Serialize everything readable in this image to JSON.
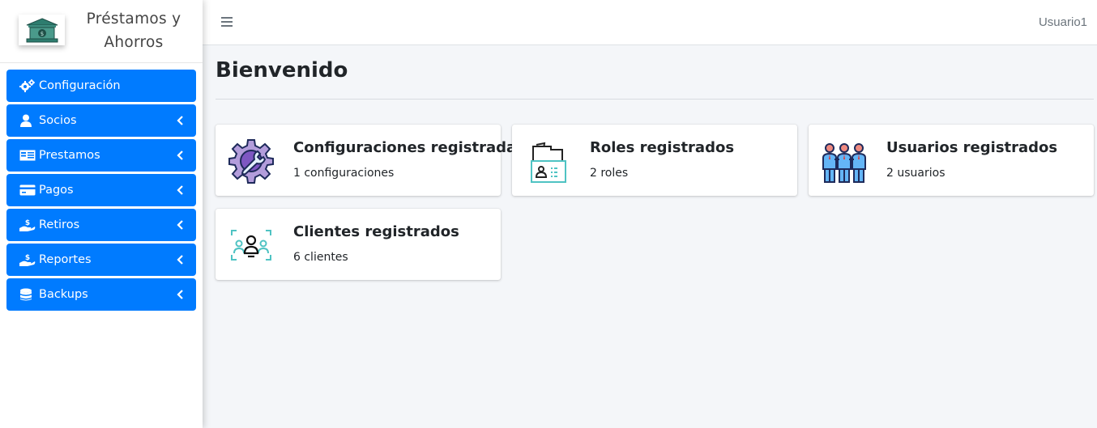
{
  "brand": {
    "line1": "Préstamos y",
    "line2": "Ahorros",
    "logo_icon": "bank-icon"
  },
  "sidebar": {
    "items": [
      {
        "label": "Configuración",
        "icon": "gears-icon",
        "has_chevron": false
      },
      {
        "label": "Socios",
        "icon": "user-icon",
        "has_chevron": true
      },
      {
        "label": "Prestamos",
        "icon": "id-card-icon",
        "has_chevron": true
      },
      {
        "label": "Pagos",
        "icon": "credit-card-icon",
        "has_chevron": true
      },
      {
        "label": "Retiros",
        "icon": "hand-holding-dollar-icon",
        "has_chevron": true
      },
      {
        "label": "Reportes",
        "icon": "hand-holding-dollar-icon",
        "has_chevron": true
      },
      {
        "label": "Backups",
        "icon": "database-icon",
        "has_chevron": true
      }
    ]
  },
  "topbar": {
    "user": "Usuario1",
    "menu_icon": "hamburger-icon"
  },
  "main": {
    "title": "Bienvenido",
    "cards": [
      {
        "title": "Configuraciones registradas",
        "subtitle": "1 configuraciones",
        "icon": "gear-wrench-icon"
      },
      {
        "title": "Roles registrados",
        "subtitle": "2 roles",
        "icon": "folder-badge-icon"
      },
      {
        "title": "Usuarios registrados",
        "subtitle": "2 usuarios",
        "icon": "team-icon"
      },
      {
        "title": "Clientes registrados",
        "subtitle": "6 clientes",
        "icon": "clients-icon"
      }
    ]
  },
  "colors": {
    "accent": "#007bff",
    "background": "#f4f6f9",
    "text": "#212529",
    "muted": "#6c757d"
  }
}
